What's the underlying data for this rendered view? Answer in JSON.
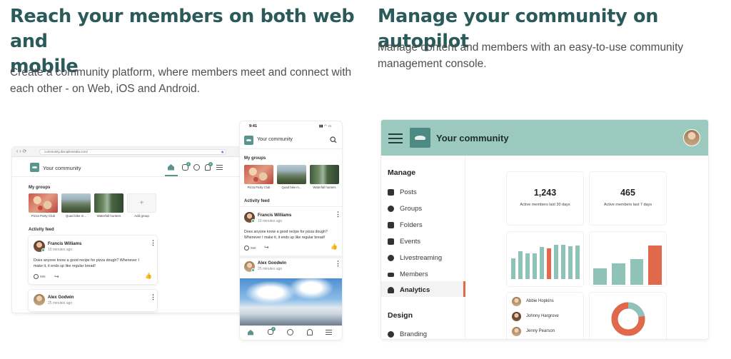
{
  "left": {
    "heading": "Reach your members on both web and mobile",
    "heading_line1": "Reach your members on both web and",
    "heading_line2": "mobile",
    "desc_line1": "Create a community platform, where members meet and connect with",
    "desc_line2": "each other - on Web, iOS and Android."
  },
  "right": {
    "heading": "Manage your community on autopilot",
    "desc_line1": "Manage content and members with an easy-to-use community",
    "desc_line2": "management console."
  },
  "web": {
    "url": "community.disciplemedia.com/",
    "app_title": "Your community",
    "my_groups": "My groups",
    "groups": [
      {
        "name": "Pizza Party Club"
      },
      {
        "name": "Quad bike m..."
      },
      {
        "name": "Waterfall hunters"
      },
      {
        "name": "Add group"
      }
    ],
    "add_symbol": "+",
    "activity_feed": "Activity feed",
    "post1": {
      "author": "Francis Williams",
      "time": "10 minutes ago",
      "text1": "Does anyone know a good recipe for pizza dough? Whenever I",
      "text2": "make it, it ends up like regular bread!",
      "reactions": "999"
    },
    "post2": {
      "author": "Alex Godwin",
      "time": "25 minutes ago"
    },
    "badge1": "2",
    "badge2": "2"
  },
  "mobile": {
    "time": "9:41",
    "app_title": "Your community",
    "my_groups": "My groups",
    "groups": [
      {
        "name": "Pizza Party Club"
      },
      {
        "name": "Quad bike m..."
      },
      {
        "name": "Waterfall hunters"
      }
    ],
    "activity_feed": "Activity feed",
    "post1": {
      "author": "Francis Williams",
      "time": "10 minutes ago",
      "text1": "Does anyone know a good recipe for pizza dough?",
      "text2": "Whenever I make it, it ends up like regular bread!",
      "reactions": "999"
    },
    "post2": {
      "author": "Alex Goodwin",
      "time": "25 minutes ago"
    },
    "badge": "2"
  },
  "console": {
    "title": "Your community",
    "manage_label": "Manage",
    "design_label": "Design",
    "nav": [
      {
        "label": "Posts",
        "icon": "posts-icon"
      },
      {
        "label": "Groups",
        "icon": "groups-icon"
      },
      {
        "label": "Folders",
        "icon": "folder-icon"
      },
      {
        "label": "Events",
        "icon": "calendar-icon"
      },
      {
        "label": "Livestreaming",
        "icon": "play-icon"
      },
      {
        "label": "Members",
        "icon": "members-icon"
      },
      {
        "label": "Analytics",
        "icon": "gauge-icon"
      }
    ],
    "design_nav": [
      {
        "label": "Branding",
        "icon": "palette-icon"
      }
    ],
    "active_item": "Analytics",
    "stat1": {
      "value": "1,243",
      "label": "Active members last 30 days"
    },
    "stat2": {
      "value": "465",
      "label": "Active members last 7 days"
    },
    "members": [
      "Abbie Hopkins",
      "Johnny Hargrove",
      "Jenny Pearson"
    ],
    "bars1": [
      0.52,
      0.7,
      0.64,
      0.64,
      0.8,
      0.76,
      0.86,
      0.86,
      0.82,
      0.84
    ],
    "bars1_highlight": 5,
    "bars2": [
      0.42,
      0.55,
      0.65,
      1.0
    ],
    "bars2_highlight": 3,
    "donut_fraction": 0.78,
    "colors": {
      "teal": "#8fc3b7",
      "accent": "#e2684b",
      "header": "#9cc9bd",
      "heading": "#2b5a5b"
    }
  }
}
